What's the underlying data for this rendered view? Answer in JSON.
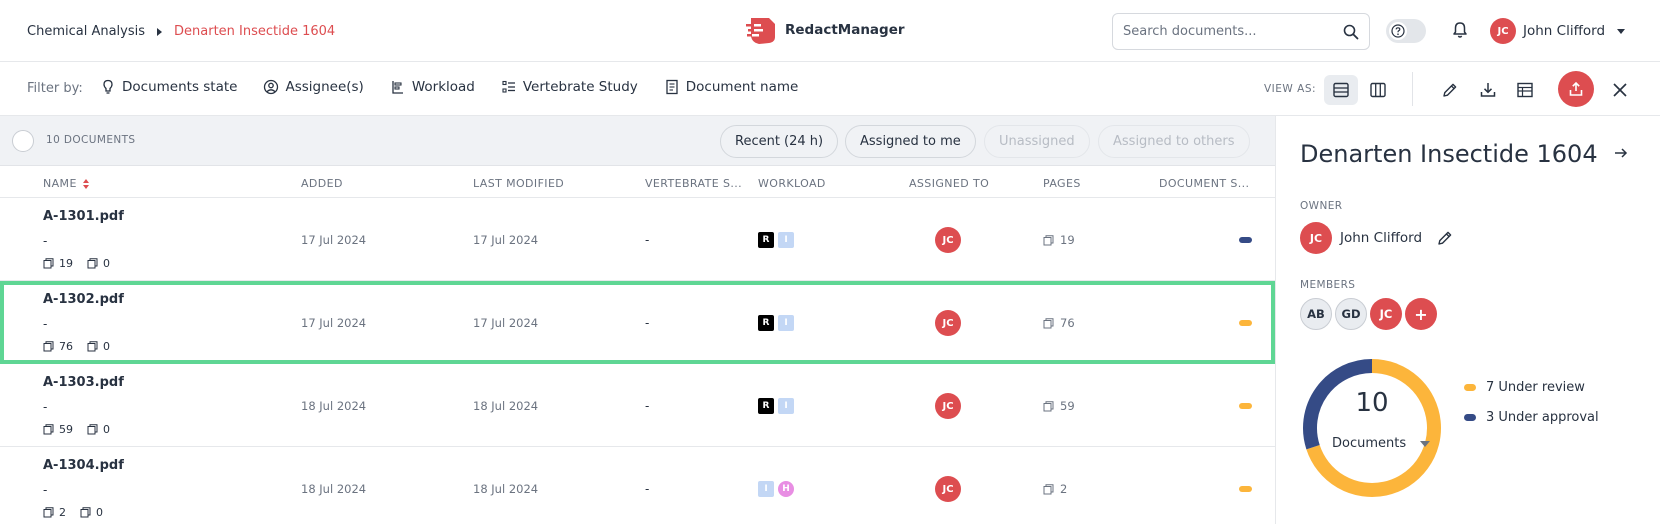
{
  "header": {
    "breadcrumb_root": "Chemical Analysis",
    "breadcrumb_current": "Denarten Insectide 1604",
    "brand_name": "RedactManager",
    "search_placeholder": "Search documents...",
    "user_initials": "JC",
    "user_name": "John Clifford"
  },
  "filterbar": {
    "label": "Filter by:",
    "filters": [
      {
        "label": "Documents state",
        "icon": "bulb-icon"
      },
      {
        "label": "Assignee(s)",
        "icon": "user-circle-icon"
      },
      {
        "label": "Workload",
        "icon": "workload-icon"
      },
      {
        "label": "Vertebrate Study",
        "icon": "list-icon"
      },
      {
        "label": "Document name",
        "icon": "document-icon"
      }
    ],
    "view_as_label": "VIEW AS:"
  },
  "list": {
    "count_label": "10 DOCUMENTS",
    "quick_filters": {
      "recent": "Recent (24 h)",
      "assigned_to_me": "Assigned to me",
      "unassigned": "Unassigned",
      "assigned_to_others": "Assigned to others"
    },
    "columns": {
      "name": "NAME",
      "added": "ADDED",
      "last_modified": "LAST MODIFIED",
      "vertebrate": "VERTEBRATE S...",
      "workload": "WORKLOAD",
      "assigned_to": "ASSIGNED TO",
      "pages": "PAGES",
      "document_status": "DOCUMENT S..."
    },
    "rows": [
      {
        "name": "A-1301.pdf",
        "sub": "-",
        "meta_pages": "19",
        "meta_files": "0",
        "added": "17 Jul 2024",
        "modified": "17 Jul 2024",
        "vertebrate": "-",
        "assignee": "JC",
        "pages": "19",
        "status_color": "#354b86"
      },
      {
        "name": "A-1302.pdf",
        "sub": "-",
        "meta_pages": "76",
        "meta_files": "0",
        "added": "17 Jul 2024",
        "modified": "17 Jul 2024",
        "vertebrate": "-",
        "assignee": "JC",
        "pages": "76",
        "status_color": "#fcb53b"
      },
      {
        "name": "A-1303.pdf",
        "sub": "-",
        "meta_pages": "59",
        "meta_files": "0",
        "added": "18 Jul 2024",
        "modified": "18 Jul 2024",
        "vertebrate": "-",
        "assignee": "JC",
        "pages": "59",
        "status_color": "#fcb53b"
      },
      {
        "name": "A-1304.pdf",
        "sub": "-",
        "meta_pages": "2",
        "meta_files": "0",
        "added": "18 Jul 2024",
        "modified": "18 Jul 2024",
        "vertebrate": "-",
        "assignee": "JC",
        "pages": "2",
        "status_color": "#fcb53b"
      }
    ],
    "workload_badges": {
      "r": "R",
      "i": "I",
      "h": "H"
    }
  },
  "side": {
    "title": "Denarten Insectide 1604",
    "owner_label": "OWNER",
    "owner_initials": "JC",
    "owner_name": "John Clifford",
    "members_label": "MEMBERS",
    "members": [
      "AB",
      "GD",
      "JC"
    ],
    "add_member": "+",
    "total": "10",
    "selector": "Documents",
    "legend": [
      {
        "label": "7 Under review",
        "value": 7,
        "color": "#fcb53b"
      },
      {
        "label": "3 Under approval",
        "value": 3,
        "color": "#354b86"
      }
    ]
  },
  "colors": {
    "accent": "#dd4d50",
    "highlight": "#5fd694"
  }
}
